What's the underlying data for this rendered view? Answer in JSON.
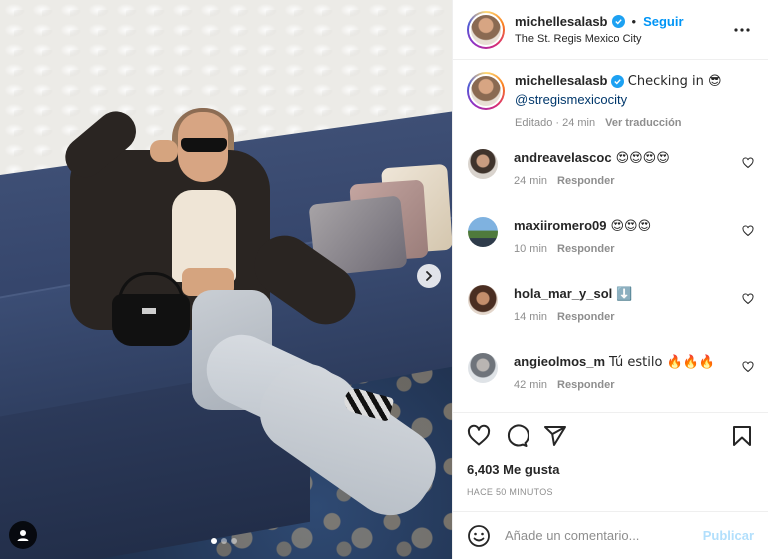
{
  "post": {
    "author": "michellesalasb",
    "separator": "•",
    "follow_label": "Seguir",
    "location": "The St. Regis Mexico City",
    "caption_text": "Checking in 😎",
    "caption_mention": "@stregismexicocity",
    "caption_edited": "Editado · 24 min",
    "caption_translate": "Ver traducción",
    "image_dots": {
      "count": 3,
      "active": 0
    }
  },
  "comments": [
    {
      "user": "andreavelascoc",
      "text": "😍😍😍😍",
      "time": "24 min",
      "reply": "Responder",
      "avatar_color": "#6b5a4e"
    },
    {
      "user": "maxiiromero09",
      "text": "😍😍😍",
      "time": "10 min",
      "reply": "Responder",
      "avatar_color": "#4f7a9c"
    },
    {
      "user": "hola_mar_y_sol",
      "text": "⬇️",
      "time": "14 min",
      "reply": "Responder",
      "avatar_color": "#7a5b48"
    },
    {
      "user": "angieolmos_m",
      "text": "Tú estilo 🔥🔥🔥",
      "time": "42 min",
      "reply": "Responder",
      "avatar_color": "#9aa3ad"
    }
  ],
  "engagement": {
    "likes": "6,403 Me gusta",
    "timestamp": "HACE 50 MINUTOS"
  },
  "composer": {
    "placeholder": "Añade un comentario...",
    "publish_label": "Publicar"
  },
  "icons": {
    "heart": "heart-icon",
    "comment": "comment-icon",
    "share": "share-icon",
    "save": "bookmark-icon",
    "more": "more-options-icon",
    "emoji": "emoji-icon",
    "next": "chevron-right-icon",
    "tag": "user-tag-icon",
    "verified": "verified-badge-icon"
  },
  "colors": {
    "link_blue": "#0095f6",
    "publish_disabled": "#b2dffc",
    "verified": "#1da1f2",
    "muted": "#8e8e8e"
  }
}
